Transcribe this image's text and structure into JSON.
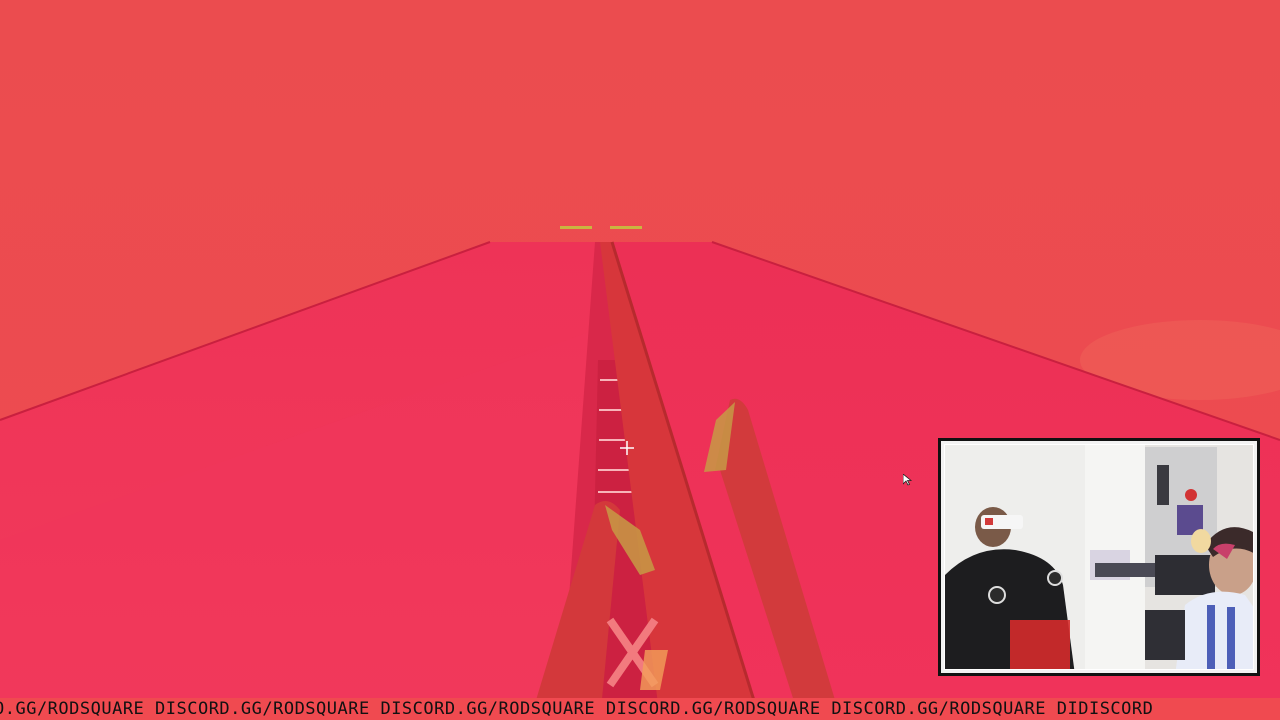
{
  "game": {
    "sky_color": "#ea4b4f",
    "track_color": "#ee2f55",
    "rail_color": "#d83a3a"
  },
  "webcam": {
    "label": "webcam overlay"
  },
  "ticker": {
    "text": "O.GG/RODSQUARE DISCORD.GG/RODSQUARE DISCORD.GG/RODSQUARE DISCORD.GG/RODSQUARE DISCORD.GG/RODSQUARE DIDISCORD"
  },
  "cursor": {
    "icon": "mouse-pointer-icon"
  }
}
